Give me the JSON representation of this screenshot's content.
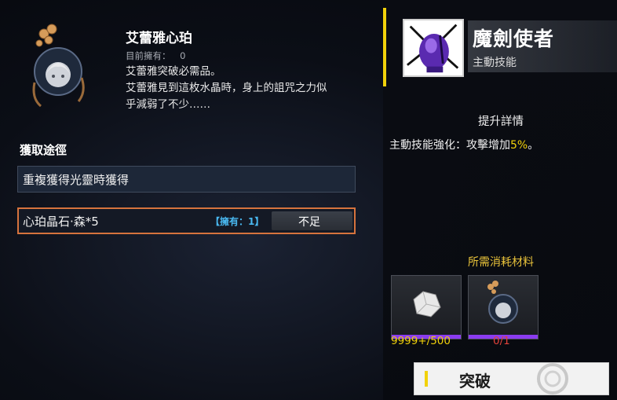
{
  "item": {
    "name": "艾蕾雅心珀",
    "owned_label": "目前擁有：",
    "owned_count": "0",
    "desc_line1": "艾蕾雅突破必需品。",
    "desc_line2": "艾蕾雅見到這枚水晶時，身上的詛咒之力似",
    "desc_line3": "乎減弱了不少……"
  },
  "acquire": {
    "title": "獲取途徑",
    "route": "重複獲得光靈時獲得"
  },
  "stone": {
    "name": "心珀晶石·森*5",
    "owned": "【擁有：1】",
    "button": "不足"
  },
  "skill": {
    "name": "魔劍使者",
    "type": "主動技能",
    "upgrade_title": "提升詳情",
    "upgrade_desc_prefix": "主動技能強化：攻擊增加",
    "upgrade_value": "5%",
    "upgrade_desc_suffix": "。"
  },
  "materials": {
    "title": "所需消耗材料",
    "items": [
      {
        "count": "9999+/500",
        "color": "#f2d20a"
      },
      {
        "count": "0/1",
        "color": "#e0413a"
      }
    ]
  },
  "actions": {
    "break_label": "突破"
  },
  "colors": {
    "accent": "#f2d20a",
    "stone_border": "#d6733d",
    "owned_blue": "#49b8f0",
    "purple_bar": "#8b3cf0"
  }
}
